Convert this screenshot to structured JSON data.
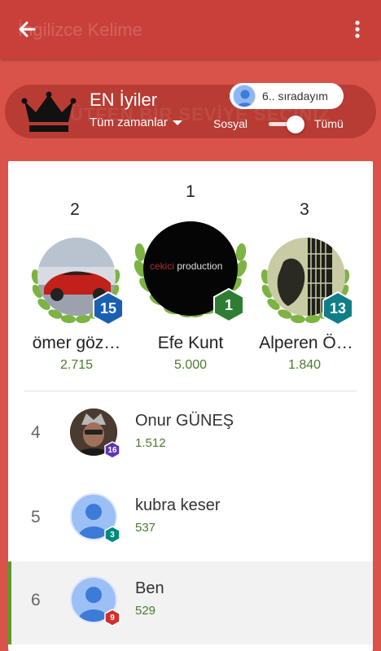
{
  "appbar": {
    "title": "İngilizce Kelime",
    "back_icon": "arrow-back-icon",
    "more_icon": "more-vert-icon"
  },
  "header": {
    "title": "EN İyiler",
    "background_hint": "ÜTFEN BİR SEVİYE SEÇİNİZ",
    "time_filter": "Tüm zamanlar",
    "rank_chip": "6.. sıradayım",
    "social_label": "Sosyal",
    "all_label": "Tümü",
    "toggle_on": true,
    "crown_icon": "crown-icon"
  },
  "podium": [
    {
      "rank": "2",
      "name": "ömer göz…",
      "score": "2.715",
      "level": "15",
      "badge_color": "#1a5fb4",
      "avatar": "red-sports-car"
    },
    {
      "rank": "1",
      "name": "Efe Kunt",
      "score": "5.000",
      "level": "1",
      "badge_color": "#2e7d32",
      "avatar_text_a": "cekici",
      "avatar_text_b": "production"
    },
    {
      "rank": "3",
      "name": "Alperen Ö…",
      "score": "1.840",
      "level": "13",
      "badge_color": "#0f7e86",
      "avatar": "guitar-photo"
    }
  ],
  "list": [
    {
      "rank": "4",
      "name": "Onur GÜNEŞ",
      "score": "1.512",
      "level": "16",
      "badge_color": "#5e35b1",
      "avatar": "photo"
    },
    {
      "rank": "5",
      "name": "kubra keser",
      "score": "537",
      "level": "3",
      "badge_color": "#00897b",
      "avatar": "default-person"
    },
    {
      "rank": "6",
      "name": "Ben",
      "score": "529",
      "level": "9",
      "badge_color": "#d32f2f",
      "avatar": "default-person",
      "is_me": true
    }
  ],
  "colors": {
    "background": "#d9534a",
    "appbar": "#c9403a",
    "score_green": "#4b7b2b",
    "laurel_green": "#7cb342"
  }
}
